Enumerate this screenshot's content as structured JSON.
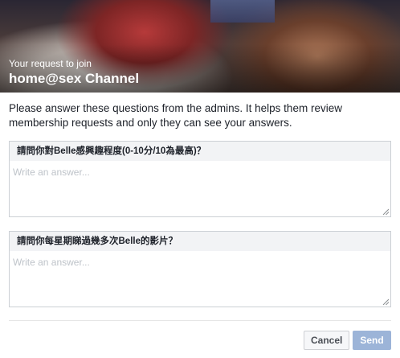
{
  "header": {
    "subtitle": "Your request to join",
    "group_name": "home@sex Channel"
  },
  "intro_text": "Please answer these questions from the admins. It helps them review membership requests and only they can see your answers.",
  "questions": [
    {
      "label": "請問你對Belle感興趣程度(0-10分/10為最高)？",
      "answer_value": "",
      "answer_placeholder": "Write an answer..."
    },
    {
      "label": "請問你每星期睇過幾多次Belle的影片？",
      "answer_value": "",
      "answer_placeholder": "Write an answer..."
    }
  ],
  "footer": {
    "cancel_label": "Cancel",
    "send_label": "Send"
  },
  "colors": {
    "send_disabled": "#9cb4d8",
    "question_header_bg": "#f2f3f5",
    "placeholder": "#bec3c9"
  }
}
